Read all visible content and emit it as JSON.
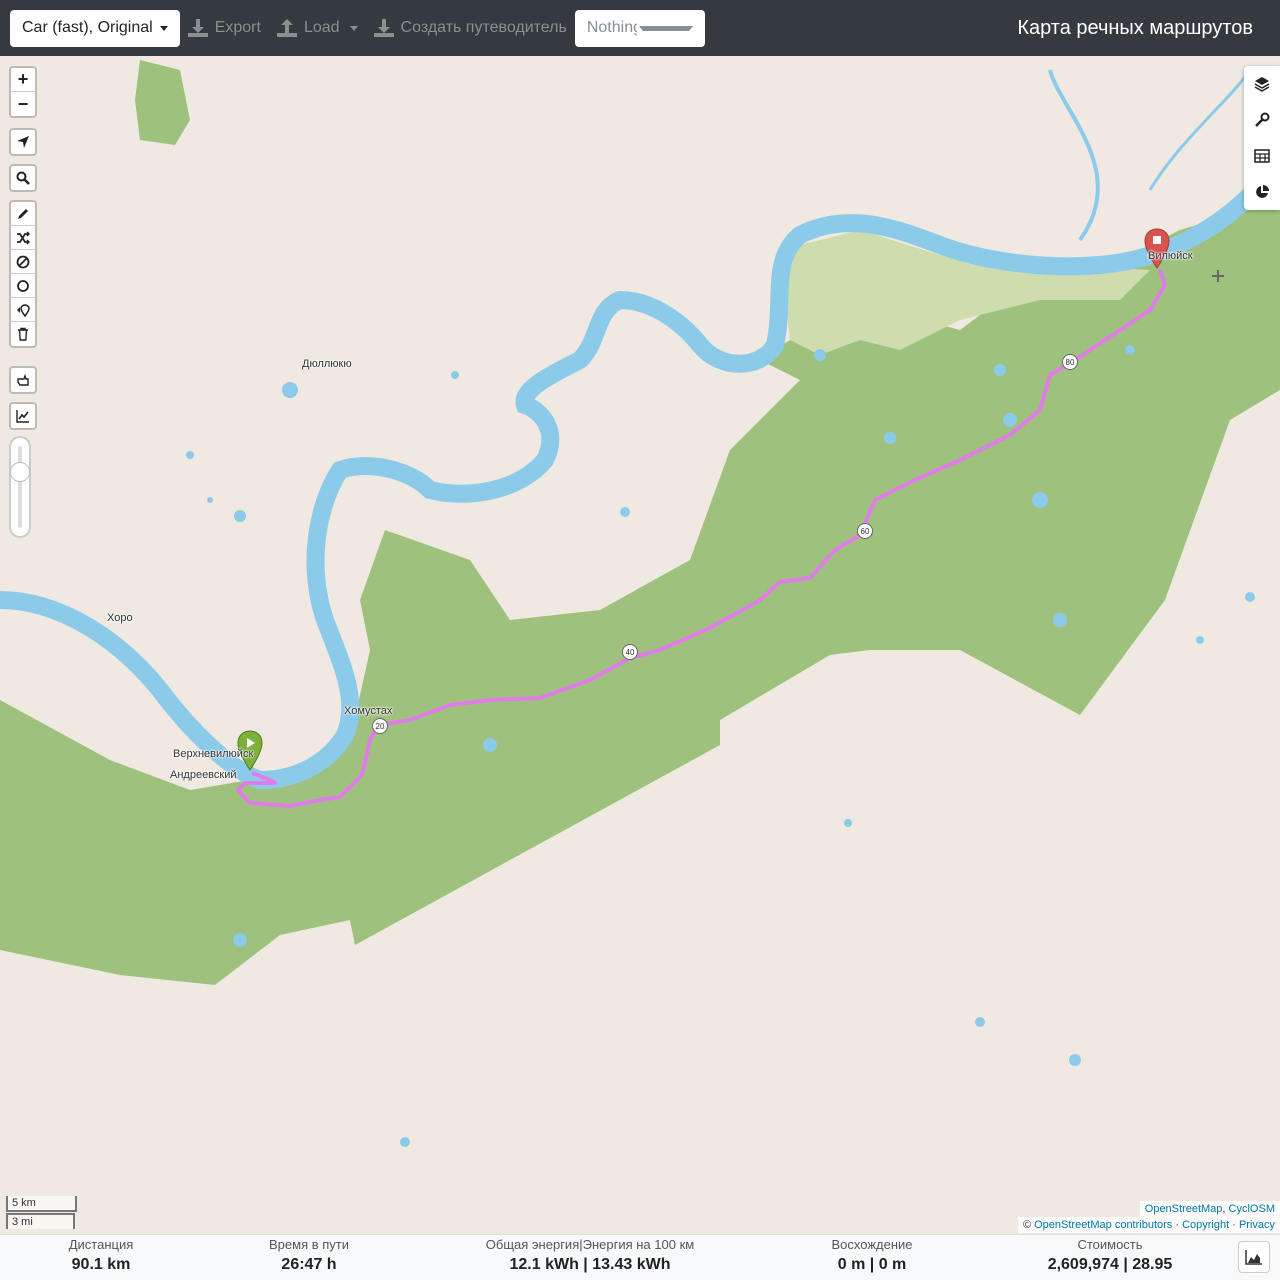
{
  "header": {
    "profile_label": "Car (fast), Original",
    "export_label": "Export",
    "load_label": "Load",
    "guide_label": "Создать путеводитель",
    "select_placeholder": "Nothing selected",
    "brand": "Карта речных маршрутов"
  },
  "map": {
    "labels": {
      "dyullyuyu": "Дюллюкю",
      "khoro": "Хоро",
      "khomustakh": "Хомустах",
      "verkhnevilyuysk": "Верхневилюйск",
      "andreevsky": "Андреевский",
      "vilyuysk": "Вилюйск"
    },
    "shields": [
      "80",
      "60",
      "40",
      "20"
    ],
    "controls": {
      "zoom_in": "+",
      "zoom_out": "−"
    },
    "scale": {
      "metric": "5 km",
      "imperial": "3 mi"
    },
    "attribution": {
      "line1_a": "OpenStreetMap",
      "line1_b": "CyclOSM",
      "line2_prefix": "©",
      "line2_a": "OpenStreetMap contributors",
      "line2_b": "Copyright",
      "line2_c": "Privacy"
    },
    "colors": {
      "land": "#efe9e1",
      "forest": "#9ec27e",
      "water": "#8ccaea",
      "route": "#e07ce8"
    }
  },
  "stats": {
    "distance": {
      "label": "Дистанция",
      "value": "90.1",
      "unit": "km"
    },
    "time": {
      "label": "Время в пути",
      "value": "26:47",
      "unit": "h"
    },
    "energy": {
      "label": "Общая энергия|Энергия на 100 км",
      "value": "12.1",
      "unit": "kWh",
      "value2": "13.43",
      "unit2": "kWh"
    },
    "ascent": {
      "label": "Восхождение",
      "value": "0",
      "unit": "m",
      "value2": "0",
      "unit2": "m"
    },
    "cost": {
      "label": "Стоимость",
      "value": "2,609,974",
      "value2": "28.95"
    }
  }
}
